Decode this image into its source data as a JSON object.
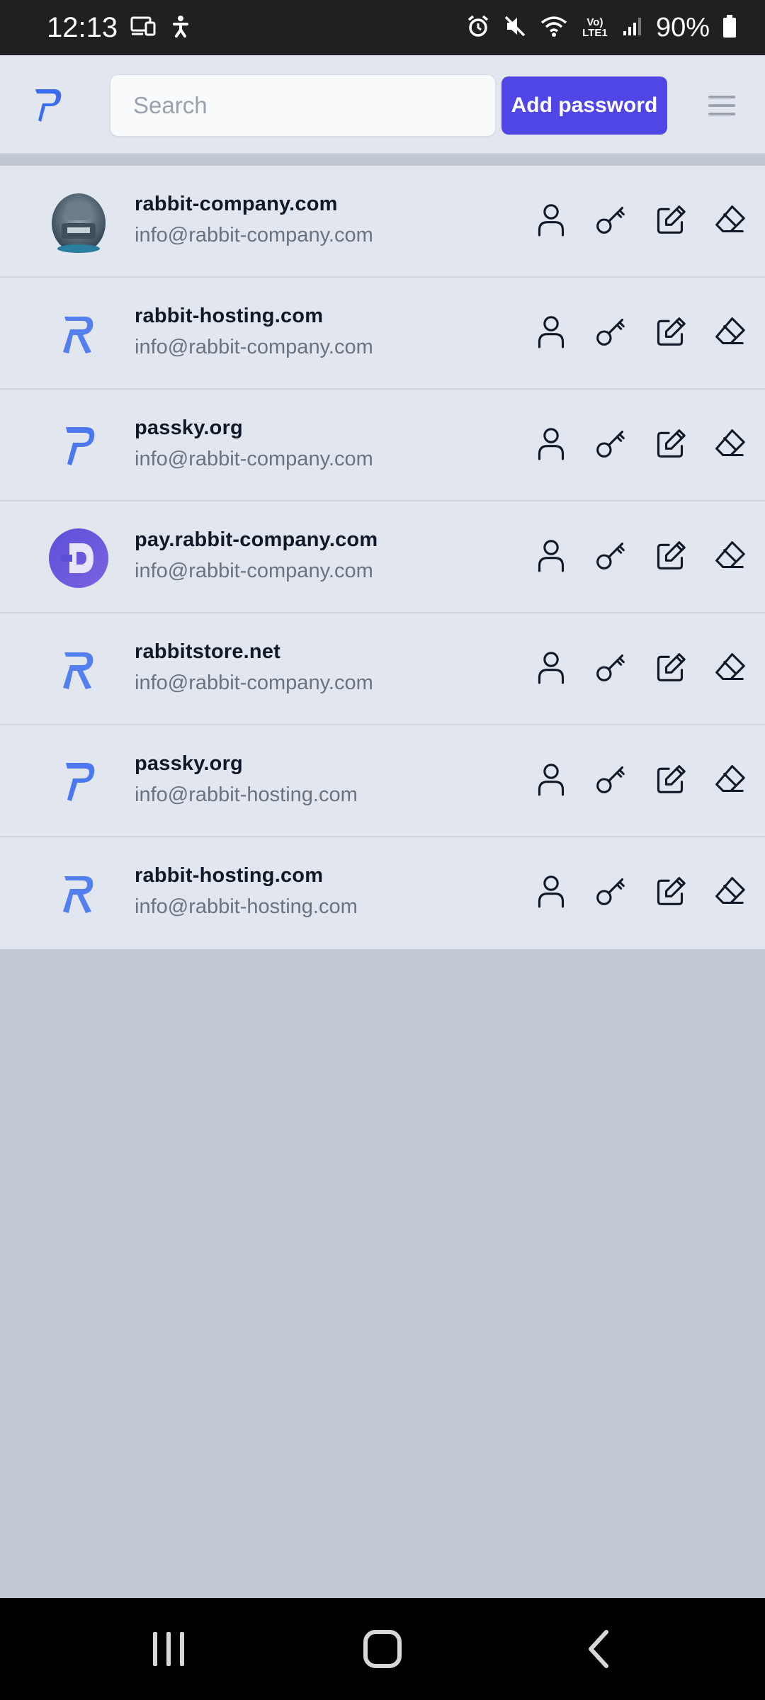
{
  "status_bar": {
    "time": "12:13",
    "battery": "90%",
    "icons": [
      "cast-icon",
      "accessibility-icon",
      "alarm-icon",
      "mute-icon",
      "wifi-icon",
      "volte-icon",
      "signal-icon",
      "battery-icon"
    ],
    "volte_label": "Vo) LTE1"
  },
  "header": {
    "logo": "passky-logo-icon",
    "search_placeholder": "Search",
    "add_button_label": "Add password",
    "menu_icon": "hamburger-icon"
  },
  "colors": {
    "accent": "#4f46e5",
    "row_bg": "#e2e7ef",
    "empty_bg": "#c3c9d4",
    "logo_blue": "#3b6cf0"
  },
  "passwords": [
    {
      "website": "rabbit-company.com",
      "username": "info@rabbit-company.com",
      "icon": "rabbit-avatar-icon"
    },
    {
      "website": "rabbit-hosting.com",
      "username": "info@rabbit-company.com",
      "icon": "rabbit-hosting-logo-icon"
    },
    {
      "website": "passky.org",
      "username": "info@rabbit-company.com",
      "icon": "passky-logo-icon"
    },
    {
      "website": "pay.rabbit-company.com",
      "username": "info@rabbit-company.com",
      "icon": "pay-logo-icon"
    },
    {
      "website": "rabbitstore.net",
      "username": "info@rabbit-company.com",
      "icon": "rabbit-hosting-logo-icon"
    },
    {
      "website": "passky.org",
      "username": "info@rabbit-hosting.com",
      "icon": "passky-logo-icon"
    },
    {
      "website": "rabbit-hosting.com",
      "username": "info@rabbit-hosting.com",
      "icon": "rabbit-hosting-logo-icon"
    }
  ],
  "row_actions": [
    "copy-username-icon",
    "copy-password-icon",
    "edit-icon",
    "delete-icon"
  ],
  "nav_bar": [
    "recent-apps-icon",
    "home-icon",
    "back-icon"
  ]
}
